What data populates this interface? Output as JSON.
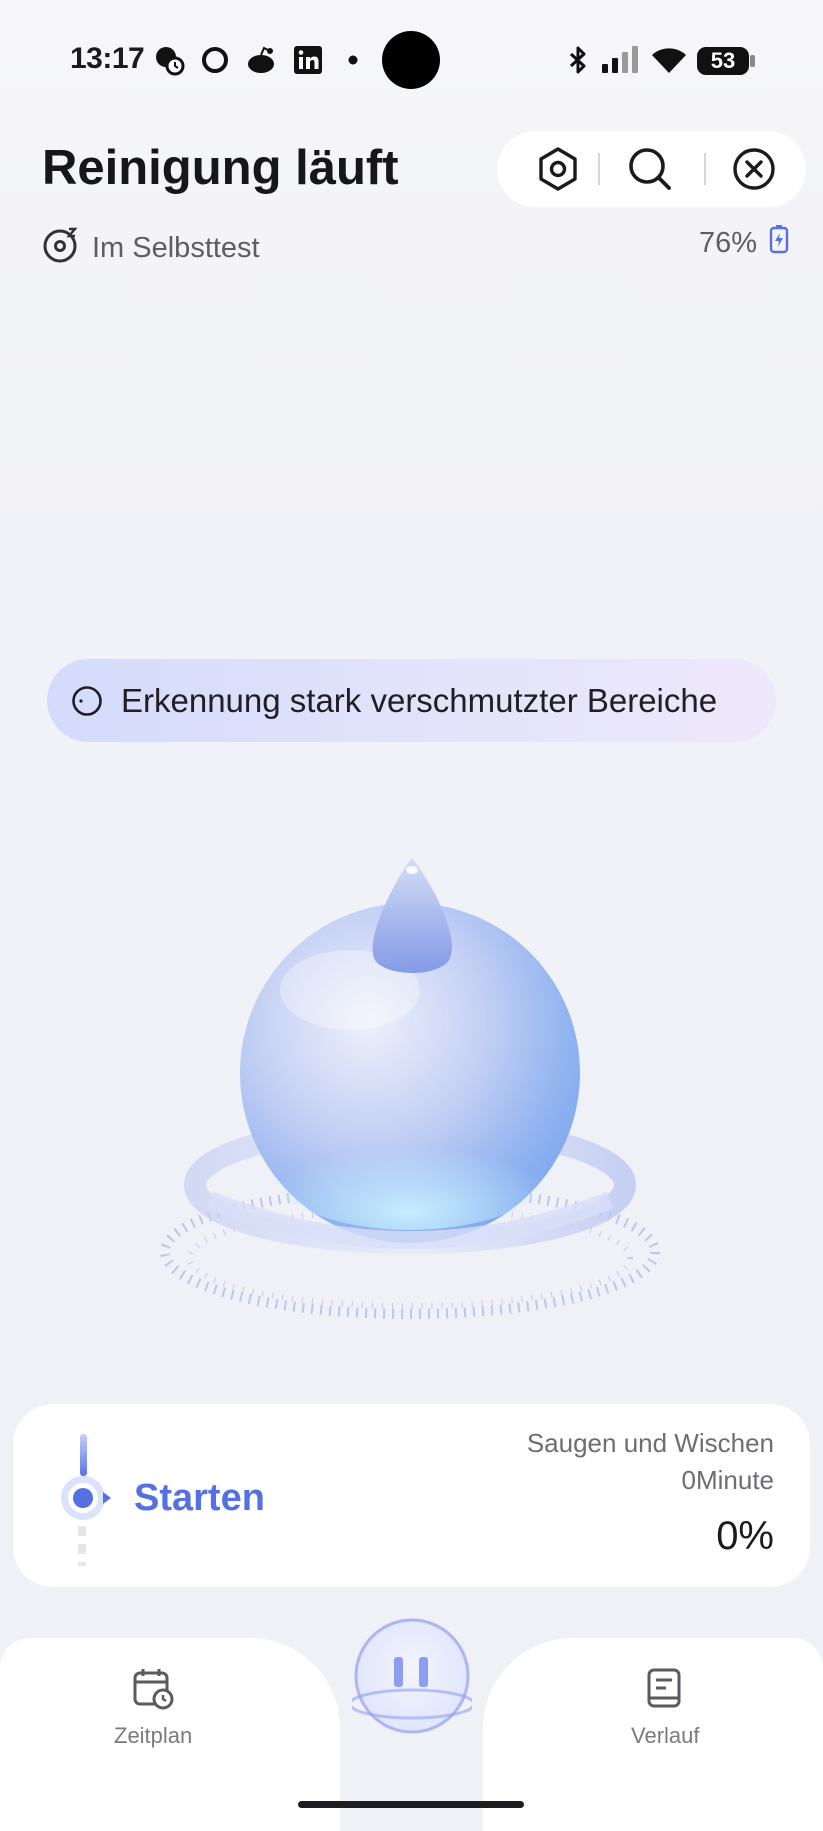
{
  "status_bar": {
    "time": "13:17",
    "icons": [
      "pet-alarm-icon",
      "circle-app-icon",
      "reddit-icon",
      "linkedin-icon",
      "dot-icon",
      "bluetooth-icon",
      "signal-icon",
      "wifi-icon"
    ],
    "battery_level": "53"
  },
  "header": {
    "title": "Reinigung läuft",
    "actions": [
      "settings-icon",
      "search-icon",
      "close-icon"
    ]
  },
  "substatus": {
    "label": "Im Selbsttest",
    "battery_percent": "76%"
  },
  "detection": {
    "text": "Erkennung stark verschmutzter Bereiche"
  },
  "progress": {
    "step_label": "Starten",
    "mode": "Saugen und Wischen",
    "duration": "0Minute",
    "percent": "0%"
  },
  "bottom_nav": {
    "left_label": "Zeitplan",
    "right_label": "Verlauf"
  },
  "colors": {
    "accent": "#5470e3",
    "pill_start": "#d4dbfb",
    "pill_end": "#eee8fb"
  }
}
